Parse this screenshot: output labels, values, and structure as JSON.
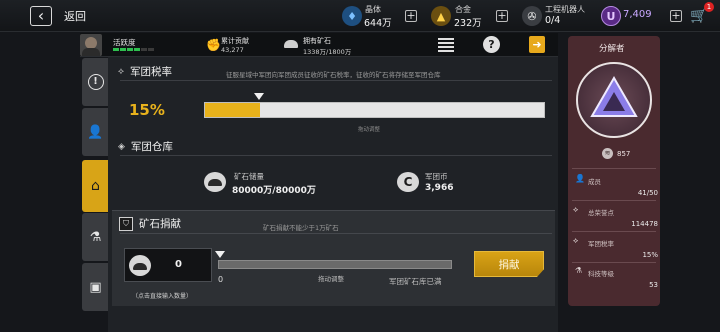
{
  "header": {
    "back_label": "返回",
    "resources": [
      {
        "name": "晶体",
        "value": "644万",
        "icon": "crystal-drop-icon",
        "color": "#4a9ee8"
      },
      {
        "name": "合金",
        "value": "232万",
        "icon": "alloy-ingot-icon",
        "color": "#d9a316"
      },
      {
        "name": "工程机器人",
        "value": "0/4",
        "icon": "robot-wrench-icon",
        "color": "#e0e0e0"
      }
    ],
    "currency_value": "7,409",
    "currency_symbol": "U",
    "cart_badge": "1"
  },
  "status": {
    "username": "活跃度",
    "contribution_label": "累计贡献",
    "contribution_value": "43,277",
    "ore_label": "拥有矿石",
    "ore_value": "1338万/1800万"
  },
  "tax": {
    "title": "军团税率",
    "description": "征服星域中军团向军团成员征收的矿石税率，征收的矿石将存储至军团仓库",
    "rate": "15%",
    "rate_fraction": 0.15,
    "slider_caption": "拖动调整"
  },
  "warehouse": {
    "title": "军团仓库",
    "ore_label": "矿石储量",
    "ore_value": "80000万/80000万",
    "coin_label": "军团币",
    "coin_value": "3,966"
  },
  "donate": {
    "title": "矿石捐献",
    "description": "矿石捐献不能少于1万矿石",
    "amount": "0",
    "amount_hint": "（点击直接输入数量）",
    "slider_min": "0",
    "slider_caption": "拖动调整",
    "full_notice": "军团矿石库已满",
    "button_label": "捐献"
  },
  "legion": {
    "name": "分解者",
    "power": "857",
    "stats": [
      {
        "label": "成员",
        "value": "41/50",
        "icon": "members-icon"
      },
      {
        "label": "总荣誉点",
        "value": "114478",
        "icon": "wings-icon"
      },
      {
        "label": "军团税率",
        "value": "15%",
        "icon": "tax-wings-icon"
      },
      {
        "label": "科技等级",
        "value": "53",
        "icon": "microscope-icon"
      }
    ]
  }
}
